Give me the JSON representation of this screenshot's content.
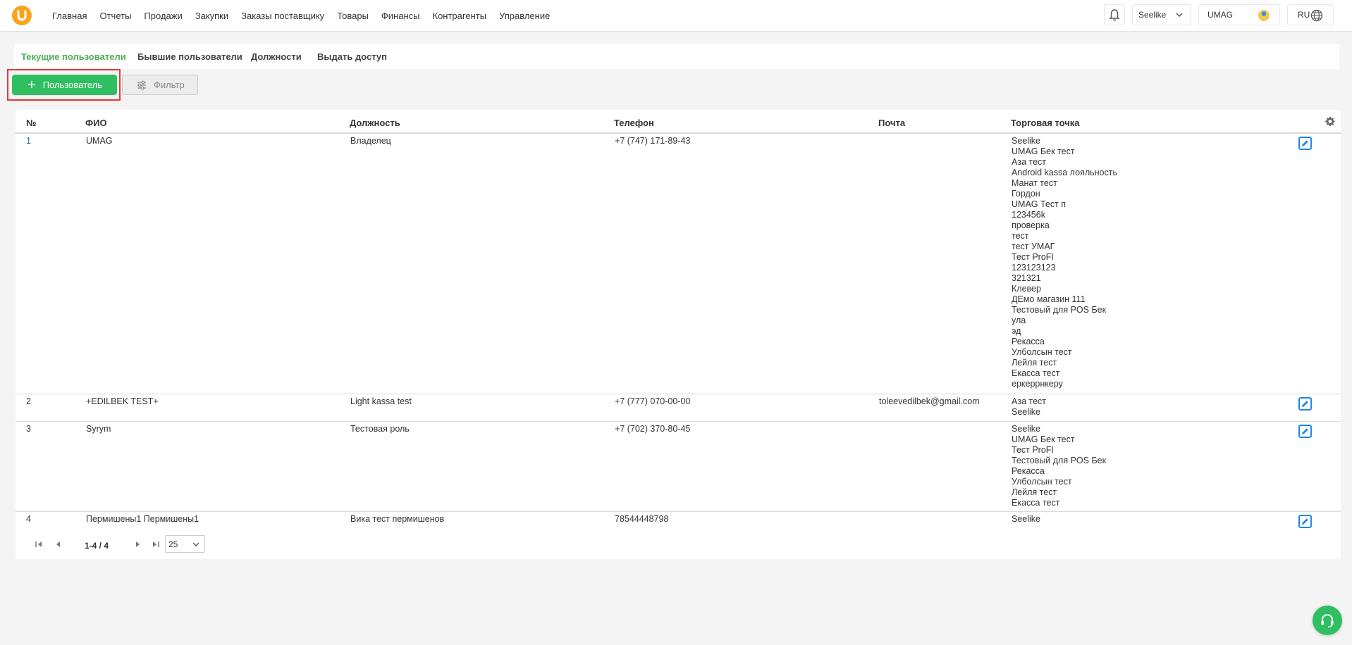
{
  "nav": {
    "items": [
      "Главная",
      "Отчеты",
      "Продажи",
      "Закупки",
      "Заказы поставщику",
      "Товары",
      "Финансы",
      "Контрагенты",
      "Управление"
    ]
  },
  "header": {
    "store": "Seelike",
    "user": "UMAG",
    "lang": "RU"
  },
  "tabs": [
    "Текущие пользователи",
    "Бывшие пользователи",
    "Должности",
    "Выдать доступ"
  ],
  "toolbar": {
    "add_label": "Пользователь",
    "filter_label": "Фильтр"
  },
  "table": {
    "columns": [
      "№",
      "ФИО",
      "Должность",
      "Телефон",
      "Почта",
      "Торговая точка"
    ],
    "rows": [
      {
        "num": "1",
        "name": "UMAG",
        "role": "Владелец",
        "phone": "+7 (747) 171-89-43",
        "email": "",
        "stores": [
          "Seelike",
          "UMAG Бек тест",
          "Аза тест",
          "Android kassa лояльность",
          "Манат тест",
          "Гордон",
          "UMAG Тест п",
          "123456k",
          "проверка",
          "тест",
          "тест УМАГ",
          "Тест ProFI",
          "123123123",
          "321321",
          "Клевер",
          "ДЕмо магазин 111",
          "Тестовый для POS Бек",
          "ула",
          "эд",
          "Рекасса",
          "Улболсын тест",
          "Лейля тест",
          "Екасса тест",
          "еркеррнкеру"
        ]
      },
      {
        "num": "2",
        "name": "+EDILBEK TEST+",
        "role": "Light kassa test",
        "phone": "+7 (777) 070-00-00",
        "email": "toleevedilbek@gmail.com",
        "stores": [
          "Аза тест",
          "Seelike"
        ]
      },
      {
        "num": "3",
        "name": "Syrym",
        "role": "Тестовая роль",
        "phone": "+7 (702) 370-80-45",
        "email": "",
        "stores": [
          "Seelike",
          "UMAG Бек тест",
          "Тест ProFI",
          "Тестовый для POS Бек",
          "Рекасса",
          "Улболсын тест",
          "Лейля тест",
          "Екасса тест"
        ]
      },
      {
        "num": "4",
        "name": "Пермишены1 Пермишены1",
        "role": "Вика тест пермишенов",
        "phone": "78544448798",
        "email": "",
        "stores": [
          "Seelike"
        ]
      }
    ]
  },
  "pagination": {
    "info": "1-4 / 4",
    "page_size": "25"
  }
}
